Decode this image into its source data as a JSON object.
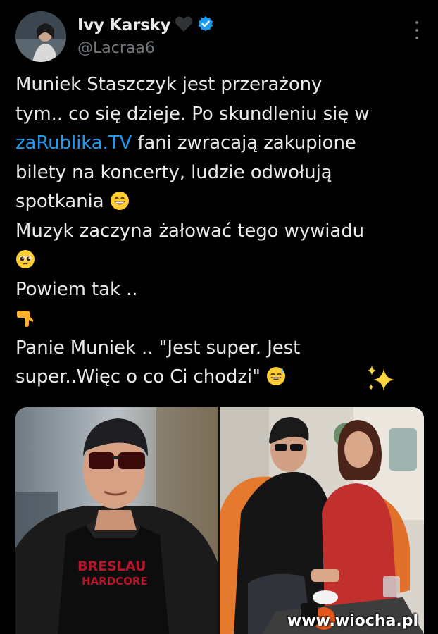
{
  "author": {
    "name": "Ivy Karsky",
    "name_heart": "🖤",
    "handle": "@Lacraa6"
  },
  "tweet": {
    "lines": [
      "Muniek Staszczyk jest przerażony",
      "tym.. co się dzieje. Po skundleniu się w",
      "fani zwracają zakupione",
      "bilety na koncerty, ludzie odwołują",
      "spotkania",
      "Muzyk zaczyna żałować tego wywiadu",
      "Powiem tak ..",
      "Panie Muniek .. \"Jest super. Jest",
      "super..Więc o co Ci chodzi\""
    ],
    "link": "zaRublika.TV"
  },
  "media": {
    "left_shirt_text_1": "BRESLAU",
    "left_shirt_text_2": "HARDCORE",
    "watermark": "www.wiocha.pl"
  },
  "colors": {
    "background": "#000000",
    "text": "#e7e9ea",
    "secondary": "#71767b",
    "link": "#1d9bf0",
    "verified": "#1d9bf0"
  }
}
